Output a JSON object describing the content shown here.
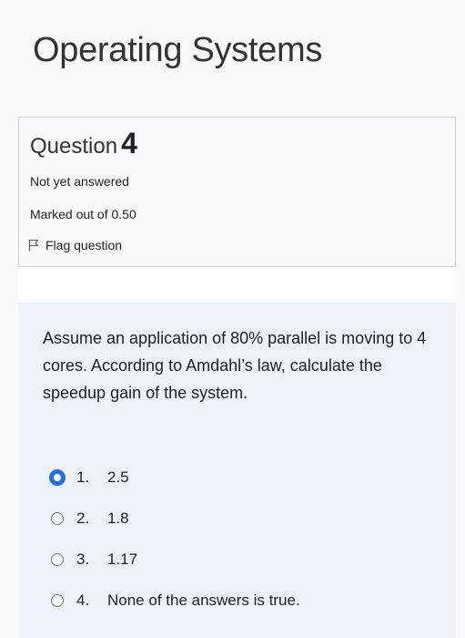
{
  "course": {
    "title": "Operating Systems"
  },
  "question_info": {
    "label": "Question",
    "number": "4",
    "state": "Not yet answered",
    "grade": "Marked out of 0.50",
    "flag_label": "Flag question"
  },
  "question": {
    "text": "Assume an application of 80% parallel is moving to 4 cores. According to Amdahl’s law, calculate the speedup gain of the system.",
    "answers": [
      {
        "number": "1.",
        "text": "2.5",
        "selected": true
      },
      {
        "number": "2.",
        "text": "1.8",
        "selected": false
      },
      {
        "number": "3.",
        "text": "1.17",
        "selected": false
      },
      {
        "number": "4.",
        "text": "None of the answers is true.",
        "selected": false
      }
    ]
  },
  "colors": {
    "accent": "#1f6feb",
    "content_bg": "#eef3fb",
    "info_bg": "#f8f9fa"
  }
}
